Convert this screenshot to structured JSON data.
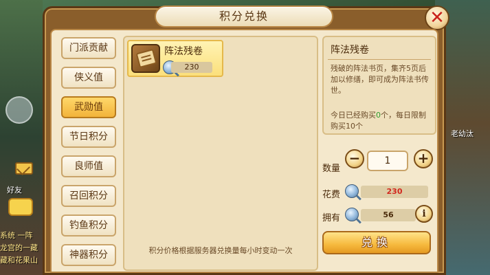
{
  "window": {
    "title": "积分兑换",
    "close_symbol": "✕"
  },
  "tabs": [
    {
      "label": "门派贡献",
      "active": false
    },
    {
      "label": "侠义值",
      "active": false
    },
    {
      "label": "武勋值",
      "active": true
    },
    {
      "label": "节日积分",
      "active": false
    },
    {
      "label": "良师值",
      "active": false
    },
    {
      "label": "召回积分",
      "active": false
    },
    {
      "label": "钓鱼积分",
      "active": false
    },
    {
      "label": "神器积分",
      "active": false
    }
  ],
  "items": [
    {
      "name": "阵法残卷",
      "price": "230",
      "icon": "scroll-icon",
      "currency_icon": "coin-icon"
    }
  ],
  "footer_note": "积分价格根据服务器兑换量每小时变动一次",
  "detail": {
    "title": "阵法残卷",
    "description": "残破的阵法书页，集齐5页后加以修缮，即可成为阵法书传世。",
    "limit_prefix": "今日已经购买",
    "limit_count": "0",
    "limit_suffix": "个，每日限制购买10个"
  },
  "purchase": {
    "quantity_label": "数量",
    "quantity_value": "1",
    "minus_symbol": "−",
    "plus_symbol": "+",
    "cost_label": "花费",
    "cost_value": "230",
    "owned_label": "拥有",
    "owned_value": "56",
    "info_symbol": "i",
    "exchange_label": "兑换"
  },
  "colors": {
    "cost_value": "#d2281e",
    "owned_value": "#4a2a0a",
    "limit_count": "#2e9b2e",
    "active_tab": "#f2b33a"
  },
  "scene": {
    "left_labels": [
      "好友"
    ],
    "chat_lines": [
      "系统  一阵",
      "龙宫的一藏",
      "藏和花果山"
    ],
    "right_label": "老幼汰"
  }
}
